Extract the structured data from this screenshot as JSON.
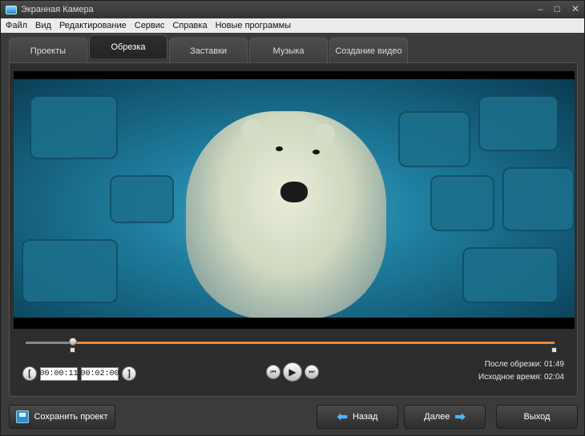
{
  "window": {
    "title": "Экранная Камера",
    "controls": [
      "–",
      "□",
      "✕"
    ]
  },
  "menu": [
    "Файл",
    "Вид",
    "Редактирование",
    "Сервис",
    "Справка",
    "Новые программы"
  ],
  "tabs": [
    {
      "label": "Проекты"
    },
    {
      "label": "Обрезка",
      "active": true
    },
    {
      "label": "Заставки"
    },
    {
      "label": "Музыка"
    },
    {
      "label": "Создание видео"
    }
  ],
  "trim": {
    "start_time": "00:00:11",
    "end_time": "00:02:00",
    "bracket_left": "[",
    "bracket_right": "]",
    "selection_start_fraction": 0.09,
    "selection_end_fraction": 1.0
  },
  "transport": {
    "prev": "⏮",
    "play": "▶",
    "next": "⏭"
  },
  "info": {
    "after_trim_label": "После обрезки:",
    "after_trim_value": "01:49",
    "source_label": "Исходное время:",
    "source_value": "02:04"
  },
  "buttons": {
    "save": "Сохранить проект",
    "back": "Назад",
    "next": "Далее",
    "exit": "Выход"
  },
  "colors": {
    "accent": "#e9883a",
    "arrow": "#4fb4ff"
  },
  "icons": {
    "save": "floppy-disk-icon",
    "back": "arrow-left-icon",
    "next": "arrow-right-icon"
  }
}
